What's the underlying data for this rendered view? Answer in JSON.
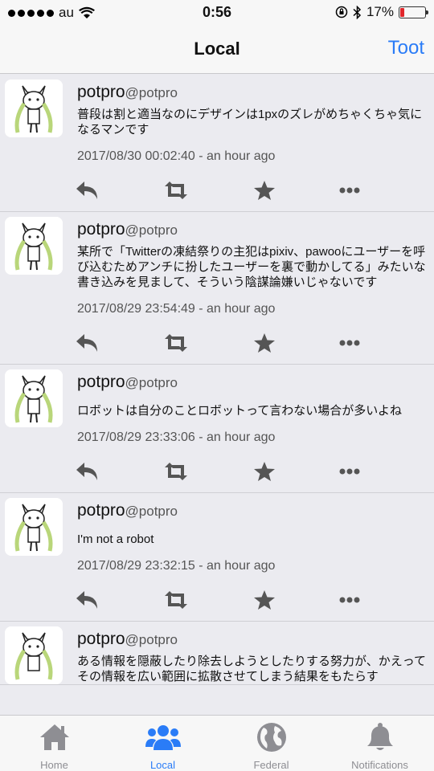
{
  "status_bar": {
    "carrier": "au",
    "time": "0:56",
    "battery": "17%"
  },
  "navbar": {
    "title": "Local",
    "toot_label": "Toot"
  },
  "posts": [
    {
      "name": "potpro",
      "handle": "@potpro",
      "text": "普段は割と適当なのにデザインは1pxのズレがめちゃくちゃ気になるマンです",
      "time": "2017/08/30 00:02:40 - an hour ago"
    },
    {
      "name": "potpro",
      "handle": "@potpro",
      "text": "某所で「Twitterの凍結祭りの主犯はpixiv、pawooにユーザーを呼び込むためアンチに扮したユーザーを裏で動かしてる」みたいな書き込みを見まして、そういう陰謀論嫌いじゃないです",
      "time": "2017/08/29 23:54:49 - an hour ago"
    },
    {
      "name": "potpro",
      "handle": "@potpro",
      "text": "ロボットは自分のことロボットって言わない場合が多いよね",
      "time": "2017/08/29 23:33:06 - an hour ago"
    },
    {
      "name": "potpro",
      "handle": "@potpro",
      "text": "I'm not a robot",
      "time": "2017/08/29 23:32:15 - an hour ago"
    },
    {
      "name": "potpro",
      "handle": "@potpro",
      "text": "ある情報を隠蔽したり除去しようとしたりする努力が、かえってその情報を広い範囲に拡散させてしまう結果をもたらす",
      "time": ""
    }
  ],
  "tabs": [
    {
      "label": "Home",
      "icon": "home-icon"
    },
    {
      "label": "Local",
      "icon": "users-icon"
    },
    {
      "label": "Federal",
      "icon": "globe-icon"
    },
    {
      "label": "Notifications",
      "icon": "bell-icon"
    }
  ],
  "colors": {
    "accent": "#2a7cf7",
    "inactive": "#8e8e93",
    "battery_low": "#e0262a"
  }
}
